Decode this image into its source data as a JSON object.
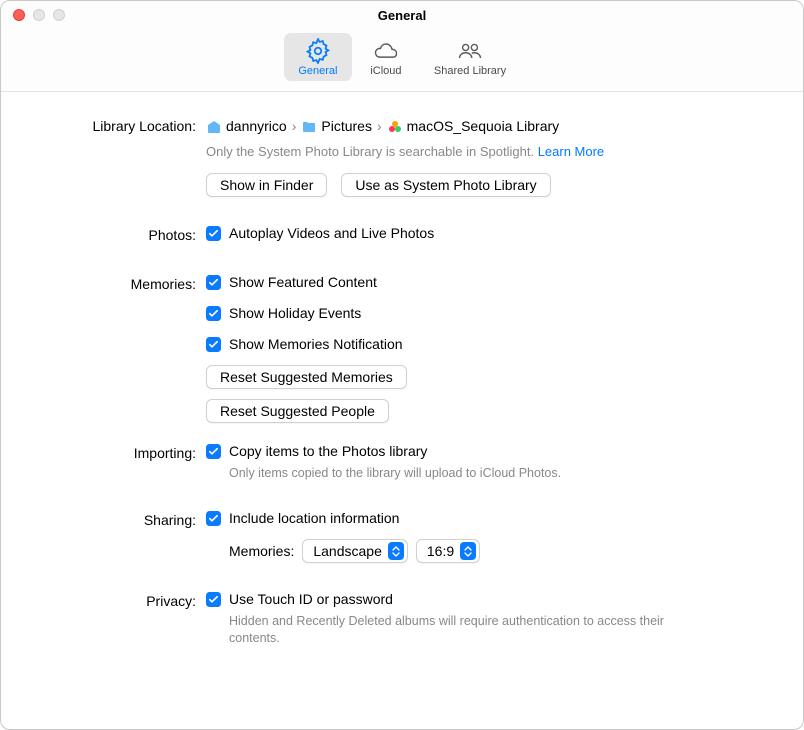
{
  "window": {
    "title": "General"
  },
  "tabs": {
    "general": "General",
    "icloud": "iCloud",
    "shared": "Shared Library"
  },
  "library_location": {
    "label": "Library Location:",
    "path": {
      "segment1": "dannyrico",
      "segment2": "Pictures",
      "segment3": "macOS_Sequoia Library"
    },
    "helper": "Only the System Photo Library is searchable in Spotlight.",
    "learn_more": "Learn More",
    "show_in_finder": "Show in Finder",
    "use_as_system": "Use as System Photo Library"
  },
  "photos": {
    "label": "Photos:",
    "autoplay": "Autoplay Videos and Live Photos"
  },
  "memories": {
    "label": "Memories:",
    "show_featured": "Show Featured Content",
    "show_holiday": "Show Holiday Events",
    "show_notification": "Show Memories Notification",
    "reset_memories": "Reset Suggested Memories",
    "reset_people": "Reset Suggested People"
  },
  "importing": {
    "label": "Importing:",
    "copy_items": "Copy items to the Photos library",
    "helper": "Only items copied to the library will upload to iCloud Photos."
  },
  "sharing": {
    "label": "Sharing:",
    "include_location": "Include location information",
    "memories_label": "Memories:",
    "orientation": "Landscape",
    "aspect": "16:9"
  },
  "privacy": {
    "label": "Privacy:",
    "use_touchid": "Use Touch ID or password",
    "helper": "Hidden and Recently Deleted albums will require authentication to access their contents."
  }
}
